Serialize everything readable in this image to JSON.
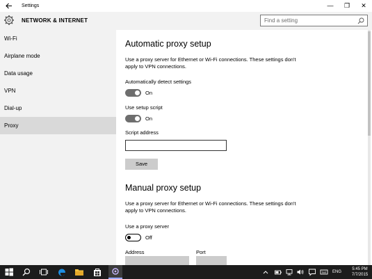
{
  "window": {
    "title": "Settings",
    "back_icon": "arrow-left-icon",
    "minimize_glyph": "—",
    "maximize_glyph": "❐",
    "close_glyph": "✕"
  },
  "header": {
    "title": "NETWORK & INTERNET",
    "icon": "gear-icon",
    "search_placeholder": "Find a setting"
  },
  "sidebar": {
    "items": [
      {
        "label": "Wi-Fi",
        "selected": false
      },
      {
        "label": "Airplane mode",
        "selected": false
      },
      {
        "label": "Data usage",
        "selected": false
      },
      {
        "label": "VPN",
        "selected": false
      },
      {
        "label": "Dial-up",
        "selected": false
      },
      {
        "label": "Proxy",
        "selected": true
      }
    ]
  },
  "automatic": {
    "heading": "Automatic proxy setup",
    "description": "Use a proxy server for Ethernet or Wi-Fi connections. These settings don't apply to VPN connections.",
    "detect_label": "Automatically detect settings",
    "detect_state": "On",
    "script_label": "Use setup script",
    "script_state": "On",
    "address_label": "Script address",
    "address_value": "",
    "save_label": "Save"
  },
  "manual": {
    "heading": "Manual proxy setup",
    "description": "Use a proxy server for Ethernet or Wi-Fi connections. These settings don't apply to VPN connections.",
    "use_label": "Use a proxy server",
    "use_state": "Off",
    "address_label": "Address",
    "port_label": "Port"
  },
  "taskbar": {
    "language": "ENG",
    "time": "5:45 PM",
    "date": "7/7/2015"
  },
  "colors": {
    "sidebar_bg": "#f2f2f2",
    "selected_bg": "#d9d9d9",
    "toggle_on": "#6e6e6e",
    "button_bg": "#cccccc",
    "taskbar_bg": "#1c1c1c"
  }
}
